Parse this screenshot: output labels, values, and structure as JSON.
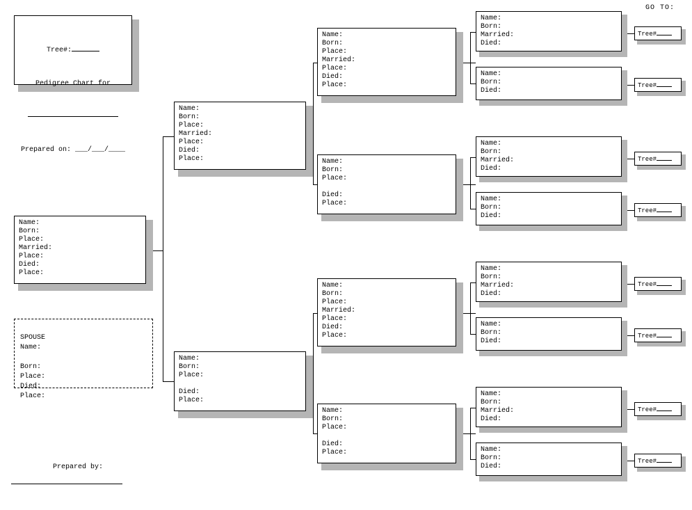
{
  "header": {
    "tree_label": "Tree#:",
    "pedigree_label": "Pedigree Chart for",
    "prepared_on_label": "Prepared on:",
    "date_blank": "___/___/____"
  },
  "goto_label": "GO TO:",
  "prepared_by_label": "Prepared by:",
  "spouse": {
    "title": "SPOUSE",
    "name": "Name:",
    "born": "Born:",
    "place": "Place:",
    "died": "Died:",
    "place2": "Place:"
  },
  "fields_full": "Name:\nBorn:\nPlace:\nMarried:\nPlace:\nDied:\nPlace:",
  "fields_mid_married": "Name:\nBorn:\nPlace:\nMarried:\nPlace:\nDied:\nPlace:",
  "fields_mid_blank": "Name:\nBorn:\nPlace:\n\nDied:\nPlace:",
  "fields_small_married": "Name:\nBorn:\nMarried:\nDied:",
  "fields_small_plain": "Name:\nBorn:\nDied:",
  "tree_tag_label": "Tree#"
}
